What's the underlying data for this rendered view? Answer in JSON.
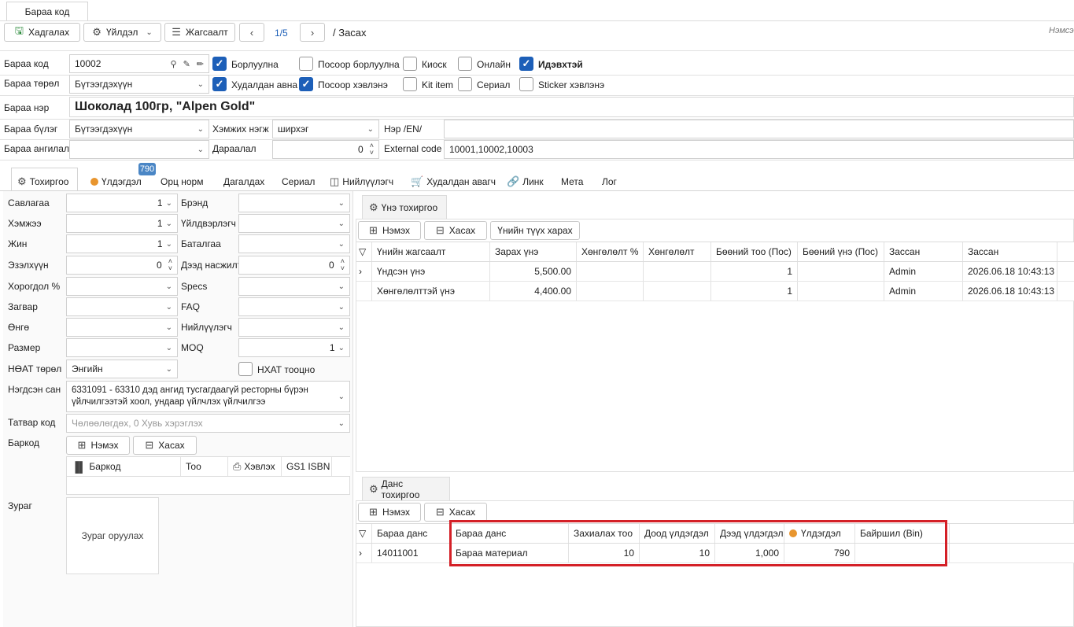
{
  "doc_tab": {
    "label": "Бараа код"
  },
  "toolbar": {
    "save_label": "Хадгалах",
    "action_label": "Үйлдэл",
    "list_label": "Жагсаалт",
    "pager": "1/5",
    "mode": "/ Засах",
    "right_text": "Нэмсэ"
  },
  "form": {
    "code_label": "Бараа код",
    "code_value": "10002",
    "type_label": "Бараа төрөл",
    "type_value": "Бүтээгдэхүүн",
    "name_label": "Бараа нэр",
    "name_value": "Шоколад 100гр, \"Alpen Gold\"",
    "group_label": "Бараа бүлэг",
    "group_value": "Бүтээгдэхүүн",
    "unit_label": "Хэмжих нэгж",
    "unit_value": "ширхэг",
    "name_en_label": "Нэр /EN/",
    "name_en_value": "",
    "category_label": "Бараа ангилал",
    "category_value": "",
    "order_label": "Дараалал",
    "order_value": "0",
    "ext_code_label": "External code",
    "ext_code_value": "10001,10002,10003"
  },
  "checks": [
    {
      "label": "Борлуулна",
      "checked": true
    },
    {
      "label": "Посоор борлуулна",
      "checked": false
    },
    {
      "label": "Киоск",
      "checked": false
    },
    {
      "label": "Онлайн",
      "checked": false
    },
    {
      "label": "Идэвхтэй",
      "checked": true
    },
    {
      "label": "Худалдан авна",
      "checked": true
    },
    {
      "label": "Посоор хэвлэнэ",
      "checked": true
    },
    {
      "label": "Kit item",
      "checked": false
    },
    {
      "label": "Сериал",
      "checked": false
    },
    {
      "label": "Sticker хэвлэнэ",
      "checked": false
    }
  ],
  "main_tabs": [
    "Тохиргоо",
    "Үлдэгдэл",
    "Орц норм",
    "Дагалдах",
    "Сериал",
    "Нийлүүлэгч",
    "Худалдан авагч",
    "Линк",
    "Мета",
    "Лог"
  ],
  "stock_badge": "790",
  "settings": {
    "pack_label": "Савлагаа",
    "pack_value": "1",
    "size_label": "Хэмжээ",
    "size_value": "1",
    "weight_label": "Жин",
    "weight_value": "1",
    "volume_label": "Эзэлхүүн",
    "volume_value": "0",
    "waste_label": "Хорогдол %",
    "waste_value": "",
    "model_label": "Загвар",
    "model_value": "",
    "color_label": "Өнгө",
    "color_value": "",
    "dim_label": "Размер",
    "dim_value": "",
    "vat_label": "НӨАТ төрөл",
    "vat_value": "Энгийн",
    "brand_label": "Брэнд",
    "brand_value": "",
    "maker_label": "Үйлдвэрлэгч",
    "maker_value": "",
    "warranty_label": "Баталгаа",
    "warranty_value": "",
    "max_label": "Дээд насжилт",
    "max_value": "0",
    "specs_label": "Specs",
    "specs_value": "",
    "faq_label": "FAQ",
    "faq_value": "",
    "supplier_label": "Нийлүүлэгч",
    "supplier_value": "",
    "moq_label": "MOQ",
    "moq_value": "1",
    "nhat_label": "НХАТ тооцно",
    "unified_label": "Нэгдсэн сан",
    "unified_value": "6331091 - 63310 дэд ангид тусгагдаагүй ресторны бүрэн үйлчилгээтэй хоол, ундаар үйлчлэх үйлчилгээ",
    "tax_label": "Татвар код",
    "tax_placeholder": "Чөлөөлөгдөх, 0 Хувь хэрэглэх",
    "barcode_label": "Баркод",
    "add_label": "Нэмэх",
    "remove_label": "Хасах",
    "barcode_cols": [
      "Баркод",
      "Тоо",
      "Хэвлэх",
      "GS1 ISBN"
    ],
    "image_label": "Зураг",
    "image_button": "Зураг оруулах"
  },
  "price": {
    "tab": "Үнэ тохиргоо",
    "add": "Нэмэх",
    "remove": "Хасах",
    "history": "Үнийн түүх харах",
    "cols": [
      "Үнийн жагсаалт",
      "Зарах үнэ",
      "Хөнгөлөлт %",
      "Хөнгөлөлт",
      "Бөөний тоо (Пос)",
      "Бөөний үнэ (Пос)",
      "Зассан",
      "Зассан"
    ],
    "rows": [
      [
        "Үндсэн үнэ",
        "5,500.00",
        "",
        "",
        "1",
        "",
        "Admin",
        "2026.06.18 10:43:13"
      ],
      [
        "Хөнгөлөлттэй үнэ",
        "4,400.00",
        "",
        "",
        "1",
        "",
        "Admin",
        "2026.06.18 10:43:13"
      ]
    ]
  },
  "account": {
    "tab": "Данс тохиргоо",
    "add": "Нэмэх",
    "remove": "Хасах",
    "cols": [
      "Бараа данс",
      "Бараа данс",
      "Захиалах тоо",
      "Доод үлдэгдэл",
      "Дээд үлдэгдэл",
      "Үлдэгдэл",
      "Байршил (Bin)"
    ],
    "rows": [
      [
        "14011001",
        "Бараа материал",
        "10",
        "10",
        "1,000",
        "790",
        ""
      ]
    ]
  },
  "colors": {
    "accent": "#1d5fb8",
    "highlight": "#d42027",
    "stock_dot": "#e8952e",
    "badge": "#4a86c5"
  }
}
